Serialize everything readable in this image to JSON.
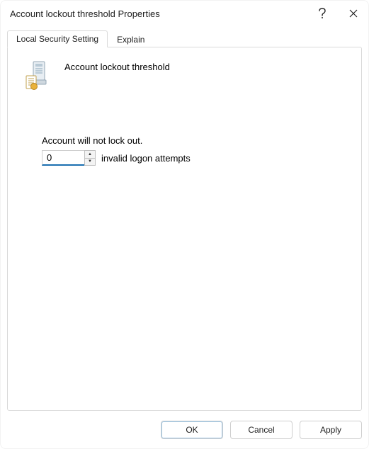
{
  "window": {
    "title": "Account lockout threshold Properties"
  },
  "tabs": {
    "local": "Local Security Setting",
    "explain": "Explain",
    "active": "local"
  },
  "policy": {
    "name": "Account lockout threshold",
    "status_line": "Account will not lock out.",
    "value": "0",
    "suffix": "invalid logon attempts"
  },
  "buttons": {
    "ok": "OK",
    "cancel": "Cancel",
    "apply": "Apply"
  }
}
